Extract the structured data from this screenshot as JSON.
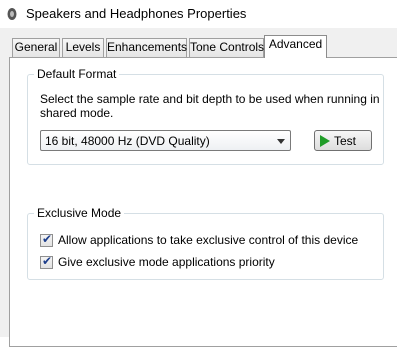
{
  "window": {
    "title": "Speakers and Headphones Properties",
    "icon": "speaker-icon"
  },
  "tabs": [
    {
      "label": "General"
    },
    {
      "label": "Levels"
    },
    {
      "label": "Enhancements"
    },
    {
      "label": "Tone Controls"
    },
    {
      "label": "Advanced",
      "selected": true
    }
  ],
  "default_format": {
    "legend": "Default Format",
    "description": "Select the sample rate and bit depth to be used when running in shared mode.",
    "selected_format": "16 bit, 48000 Hz (DVD Quality)",
    "test_button_label": "Test",
    "test_icon": "play-icon"
  },
  "exclusive_mode": {
    "legend": "Exclusive Mode",
    "options": [
      {
        "label": "Allow applications to take exclusive control of this device",
        "checked": true
      },
      {
        "label": "Give exclusive mode applications priority",
        "checked": true
      }
    ]
  },
  "colors": {
    "play_icon": "#1f9c27",
    "dialog_background": "#f0f0f0",
    "groupbox_border": "#d5dfe5"
  }
}
